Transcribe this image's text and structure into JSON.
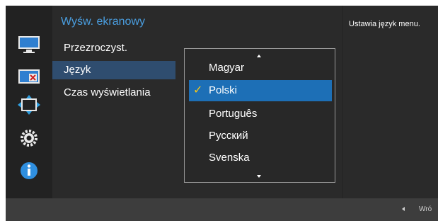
{
  "menu": {
    "title": "Wyśw. ekranowy",
    "items": [
      {
        "label": "Przezroczyst."
      },
      {
        "label": "Język"
      },
      {
        "label": "Czas wyświetlania"
      }
    ]
  },
  "language_dropdown": {
    "options": [
      "Magyar",
      "Polski",
      "Português",
      "Русский",
      "Svenska"
    ],
    "selected": "Polski"
  },
  "help": {
    "text": "Ustawia język menu."
  },
  "footer": {
    "back_label": "Wró"
  },
  "colors": {
    "accent": "#4a9ee0",
    "selection": "#1d6fb6",
    "check": "#f5c518"
  },
  "icons": [
    "picture-icon",
    "color-icon",
    "size-position-icon",
    "settings-icon",
    "info-icon"
  ]
}
